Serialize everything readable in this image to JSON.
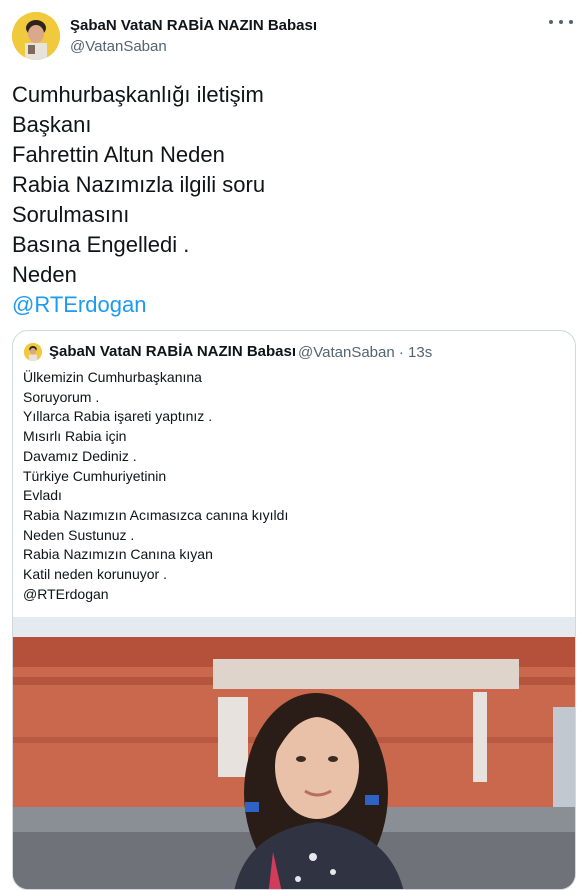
{
  "tweet": {
    "author_name": "ŞabaN VataN RABİA NAZIN Babası",
    "author_handle": "@VatanSaban",
    "text_lines": [
      "Cumhurbaşkanlığı iletişim",
      "Başkanı",
      "Fahrettin Altun Neden",
      "Rabia Nazımızla ilgili soru",
      "Sorulmasını",
      "Basına Engelledi .",
      "Neden"
    ],
    "mention": "@RTErdogan"
  },
  "quoted_tweet": {
    "author_name": "ŞabaN VataN RABİA NAZIN Babası",
    "meta": "@VatanSaban · 13s",
    "text_lines": [
      "Ülkemizin Cumhurbaşkanına",
      "Soruyorum .",
      "Yıllarca Rabia işareti yaptınız .",
      "Mısırlı Rabia için",
      "Davamız Dediniz .",
      "Türkiye Cumhuriyetinin",
      "Evladı",
      "Rabia Nazımızın Acımasızca canına kıyıldı",
      "Neden Sustunuz .",
      "Rabia Nazımızın Canına kıyan",
      "Katil neden korunuyor .",
      "@RTErdogan"
    ]
  },
  "icons": {
    "more": "more-horizontal-icon"
  },
  "colors": {
    "mention": "#1d9bf0",
    "secondary_text": "#536471",
    "border": "#cfd9de"
  }
}
